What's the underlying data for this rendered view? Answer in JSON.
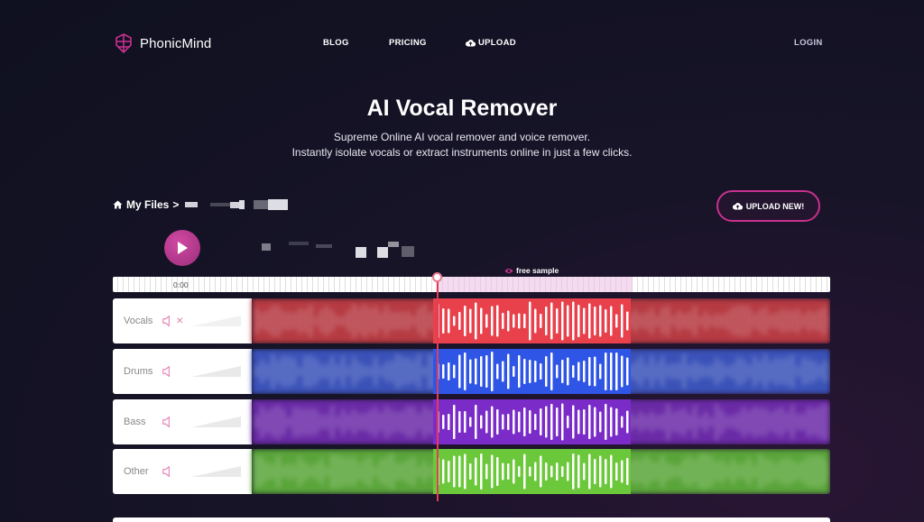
{
  "nav": {
    "logo_text": "PhonicMind",
    "blog": "BLOG",
    "pricing": "PRICING",
    "upload": "UPLOAD",
    "login": "LOGIN"
  },
  "hero": {
    "title": "AI Vocal Remover",
    "subtitle_line1": "Supreme Online AI vocal remover and voice remover.",
    "subtitle_line2": "Instantly isolate vocals or extract instruments online in just a few clicks."
  },
  "files": {
    "breadcrumb_label": "My Files",
    "separator": ">",
    "upload_new": "UPLOAD NEW!"
  },
  "player": {
    "free_sample": "free sample",
    "current_time": "0:00",
    "playhead_fraction": 0.45,
    "sample_start_fraction": 0.45,
    "sample_end_fraction": 0.725
  },
  "tracks": [
    {
      "name": "Vocals",
      "color": "#e8414c",
      "blur_color": "#b63a42",
      "muted": true
    },
    {
      "name": "Drums",
      "color": "#2f55e6",
      "blur_color": "#3a52b8",
      "muted": false
    },
    {
      "name": "Bass",
      "color": "#7b2cc8",
      "blur_color": "#6a2aa6",
      "muted": false
    },
    {
      "name": "Other",
      "color": "#6cc83b",
      "blur_color": "#5aa53a",
      "muted": false
    }
  ],
  "colors": {
    "accent": "#c8308f",
    "playhead": "#e23c56",
    "icon_pink": "#e47ab0"
  },
  "icons": {
    "logo": "brain-logo-icon",
    "upload": "cloud-upload-icon",
    "home": "home-icon",
    "play": "play-icon",
    "eye": "eye-icon",
    "speaker": "speaker-icon"
  }
}
